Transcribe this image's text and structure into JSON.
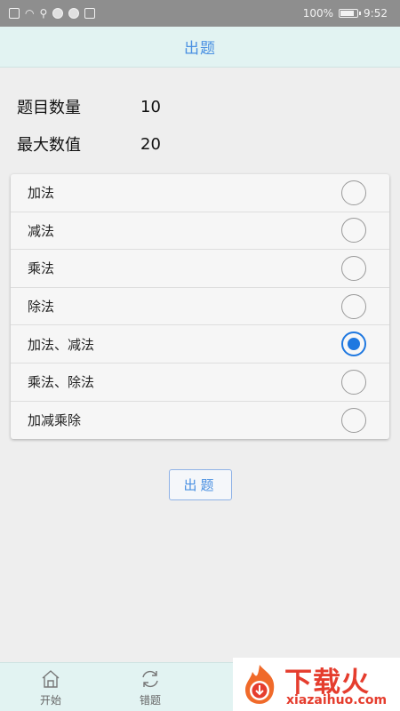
{
  "status_bar": {
    "battery": "100%",
    "time": "9:52"
  },
  "header": {
    "title": "出题"
  },
  "settings": [
    {
      "label": "题目数量",
      "value": "10"
    },
    {
      "label": "最大数值",
      "value": "20"
    }
  ],
  "options": [
    {
      "label": "加法",
      "checked": false
    },
    {
      "label": "减法",
      "checked": false
    },
    {
      "label": "乘法",
      "checked": false
    },
    {
      "label": "除法",
      "checked": false
    },
    {
      "label": "加法、减法",
      "checked": true
    },
    {
      "label": "乘法、除法",
      "checked": false
    },
    {
      "label": "加减乘除",
      "checked": false
    }
  ],
  "generate_button": {
    "label": "出题"
  },
  "bottom_nav": {
    "items": [
      {
        "label": "开始",
        "icon": "home-icon"
      },
      {
        "label": "错题",
        "icon": "refresh-icon"
      }
    ]
  },
  "watermark": {
    "title": "下载火",
    "subtitle": "xiazaihuo.com"
  },
  "colors": {
    "accent": "#4a90e2",
    "radio_active": "#1f78e0",
    "header_bg": "#e2f3f2",
    "watermark": "#e53d2e"
  }
}
